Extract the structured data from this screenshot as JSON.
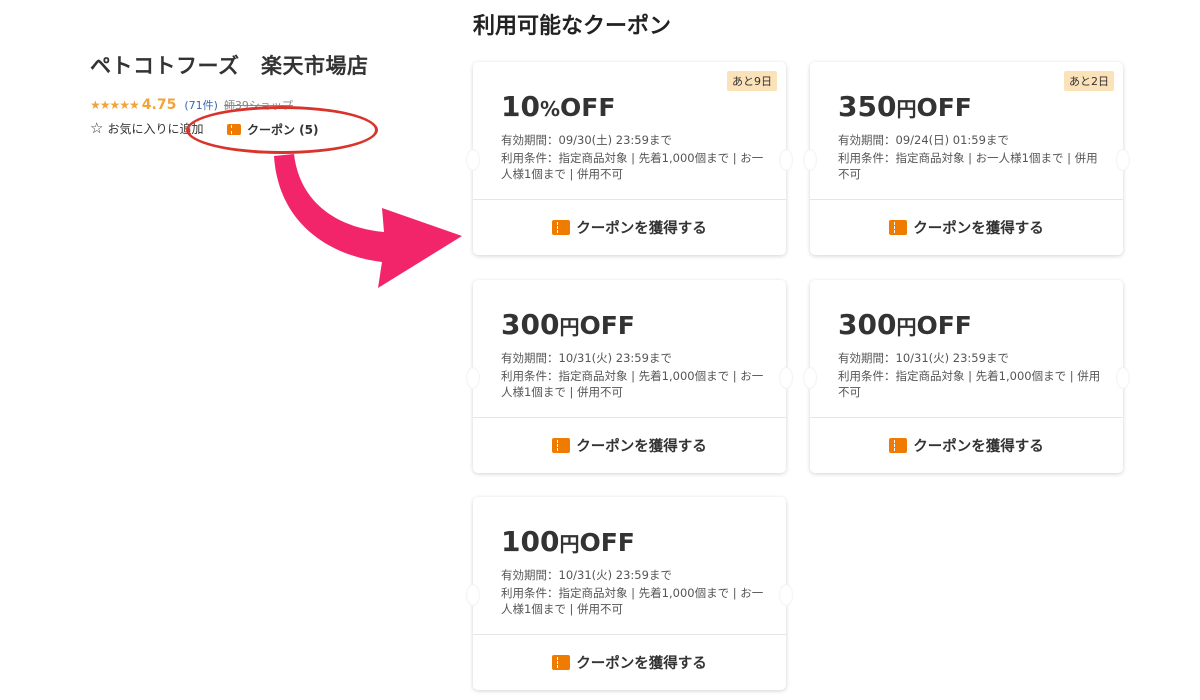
{
  "shop": {
    "name": "ペトコトフーズ　楽天市場店",
    "stars": "★★★★★",
    "score": "4.75",
    "review_count": "(71件)",
    "sub_info": "師39ショップ",
    "favorite_label": "お気に入りに追加",
    "coupon_link_label": "クーポン (5)"
  },
  "colors": {
    "accent_orange": "#ef7c00",
    "highlight_red": "#d9342b",
    "arrow_pink": "#f2256a",
    "badge_bg": "#fbe2b9"
  },
  "section_title": "利用可能なクーポン",
  "coupons": [
    {
      "discount_value": "10",
      "discount_unit": "%",
      "discount_off": "OFF",
      "badge": "あと9日",
      "validity": "有効期間：09/30(土) 23:59まで",
      "conditions": "利用条件：指定商品対象 | 先着1,000個まで | お一人様1個まで | 併用不可",
      "button_label": "クーポンを獲得する",
      "icon": "coupon-ticket-icon"
    },
    {
      "discount_value": "350",
      "discount_unit": "円",
      "discount_off": "OFF",
      "badge": "あと2日",
      "validity": "有効期間：09/24(日) 01:59まで",
      "conditions": "利用条件：指定商品対象 | お一人様1個まで | 併用不可",
      "button_label": "クーポンを獲得する",
      "icon": "coupon-ticket-icon"
    },
    {
      "discount_value": "300",
      "discount_unit": "円",
      "discount_off": "OFF",
      "badge": "",
      "validity": "有効期間：10/31(火) 23:59まで",
      "conditions": "利用条件：指定商品対象 | 先着1,000個まで | お一人様1個まで | 併用不可",
      "button_label": "クーポンを獲得する",
      "icon": "coupon-ticket-icon"
    },
    {
      "discount_value": "300",
      "discount_unit": "円",
      "discount_off": "OFF",
      "badge": "",
      "validity": "有効期間：10/31(火) 23:59まで",
      "conditions": "利用条件：指定商品対象 | 先着1,000個まで | 併用不可",
      "button_label": "クーポンを獲得する",
      "icon": "coupon-ticket-icon"
    },
    {
      "discount_value": "100",
      "discount_unit": "円",
      "discount_off": "OFF",
      "badge": "",
      "validity": "有効期間：10/31(火) 23:59まで",
      "conditions": "利用条件：指定商品対象 | 先着1,000個まで | お一人様1個まで | 併用不可",
      "button_label": "クーポンを獲得する",
      "icon": "coupon-ticket-icon"
    }
  ]
}
